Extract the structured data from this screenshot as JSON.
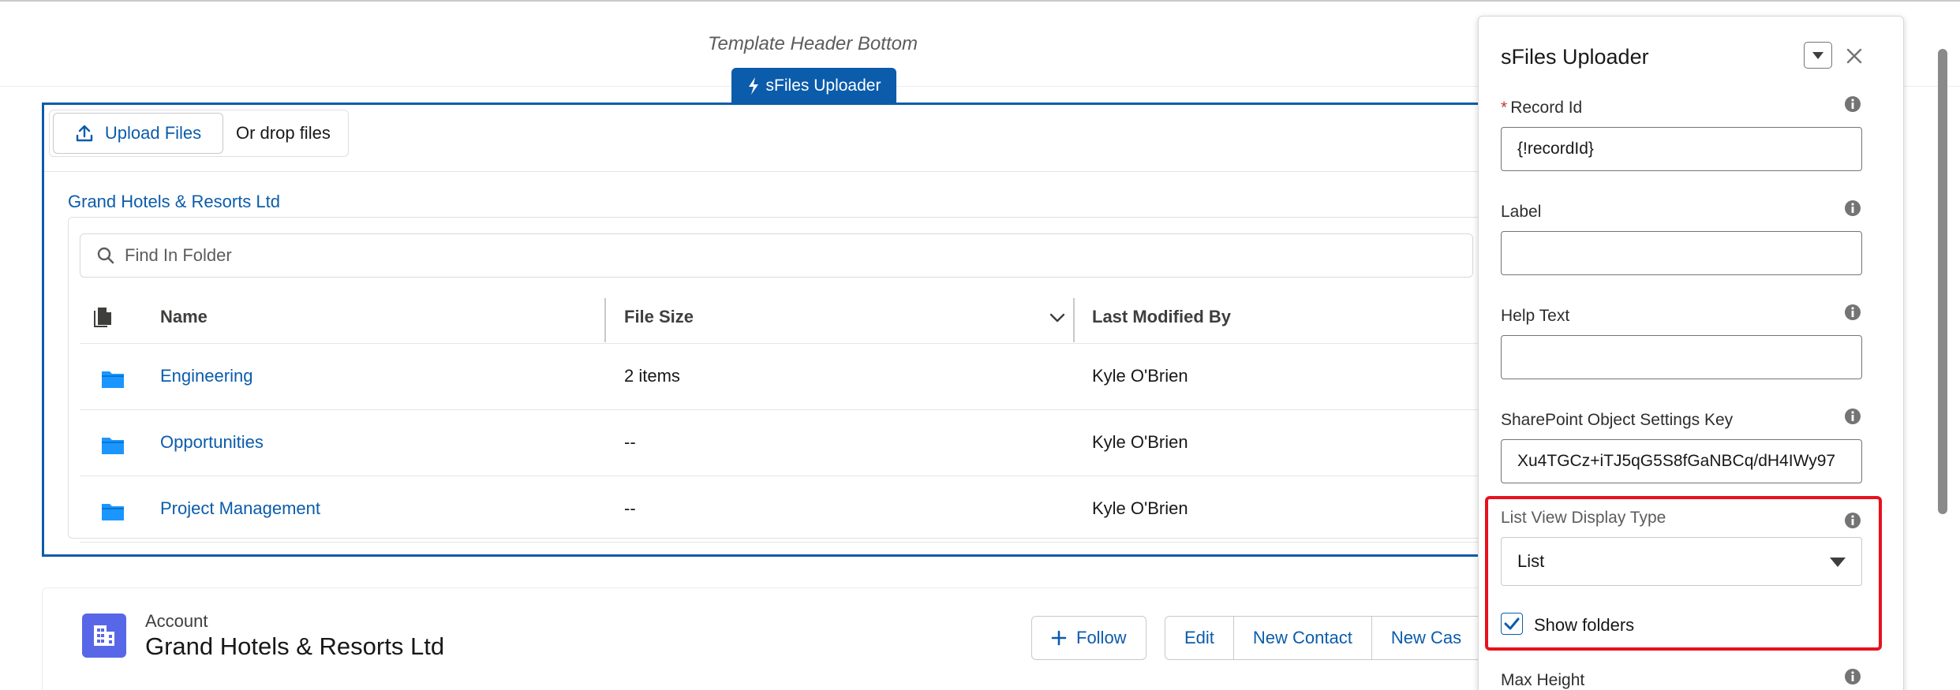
{
  "template_header": {
    "title": "Template Header Bottom"
  },
  "component_tab": {
    "label": "sFiles Uploader"
  },
  "uploader": {
    "upload_button": "Upload Files",
    "drop_text": "Or drop files",
    "breadcrumb": "Grand Hotels & Resorts Ltd",
    "search_placeholder": "Find In Folder",
    "columns": {
      "name": "Name",
      "size": "File Size",
      "modified": "Last Modified By"
    },
    "rows": [
      {
        "name": "Engineering",
        "size": "2 items",
        "modified": "Kyle O'Brien"
      },
      {
        "name": "Opportunities",
        "size": "--",
        "modified": "Kyle O'Brien"
      },
      {
        "name": "Project Management",
        "size": "--",
        "modified": "Kyle O'Brien"
      }
    ]
  },
  "account": {
    "type": "Account",
    "name": "Grand Hotels & Resorts Ltd",
    "follow": "Follow",
    "actions": [
      "Edit",
      "New Contact",
      "New Cas"
    ]
  },
  "panel": {
    "title": "sFiles Uploader",
    "record_id": {
      "label": "Record Id",
      "value": "{!recordId}"
    },
    "label_field": {
      "label": "Label",
      "value": ""
    },
    "help_text": {
      "label": "Help Text",
      "value": ""
    },
    "settings_key": {
      "label": "SharePoint Object Settings Key",
      "value": "Xu4TGCz+iTJ5qG5S8fGaNBCq/dH4IWy97"
    },
    "display_type": {
      "label": "List View Display Type",
      "value": "List"
    },
    "show_folders": {
      "label": "Show folders",
      "checked": true
    },
    "max_height": {
      "label": "Max Height"
    }
  },
  "colors": {
    "brand_blue": "#0b5cab",
    "highlight_red": "#e8111d",
    "account_icon": "#5867e8",
    "folder_blue": "#1b96ff"
  }
}
